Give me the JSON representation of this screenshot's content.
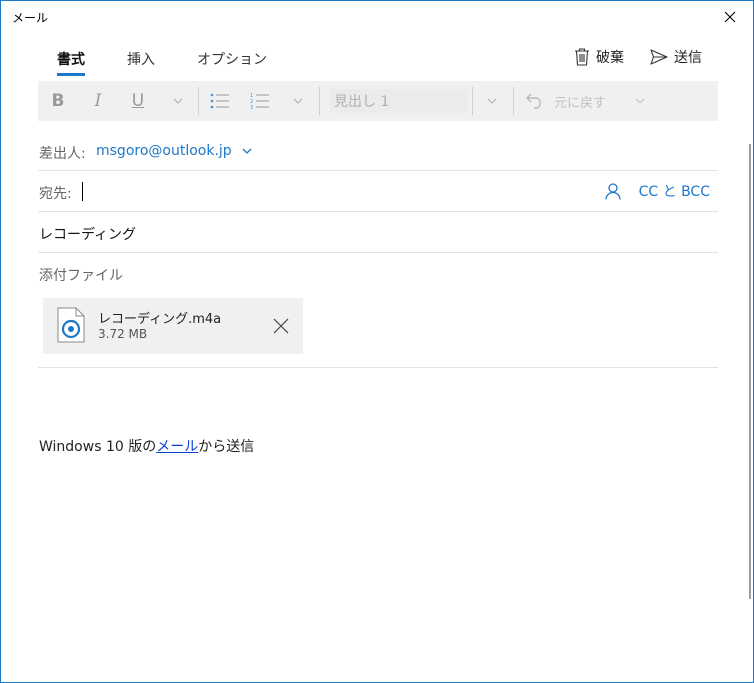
{
  "window": {
    "title": "メール"
  },
  "tabs": [
    {
      "label": "書式",
      "active": true
    },
    {
      "label": "挿入",
      "active": false
    },
    {
      "label": "オプション",
      "active": false
    }
  ],
  "actions": {
    "discard_label": "破棄",
    "send_label": "送信"
  },
  "toolbar": {
    "bold": "B",
    "italic": "I",
    "underline": "U",
    "heading_value": "見出し 1",
    "undo_label": "元に戻す"
  },
  "from": {
    "label": "差出人:",
    "value": "msgoro@outlook.jp"
  },
  "to": {
    "label": "宛先:",
    "value": "",
    "cc_bcc_label": "CC と BCC"
  },
  "subject": {
    "value": "レコーディング"
  },
  "attachments": {
    "label": "添付ファイル",
    "items": [
      {
        "name": "レコーディング.m4a",
        "size": "3.72 MB"
      }
    ]
  },
  "body": {
    "signature_prefix": "Windows 10 版の",
    "signature_link": "メール",
    "signature_suffix": "から送信"
  },
  "colors": {
    "accent": "#1e78c8",
    "link": "#0b3fd4",
    "toolbar_bg": "#f0f0f0"
  }
}
